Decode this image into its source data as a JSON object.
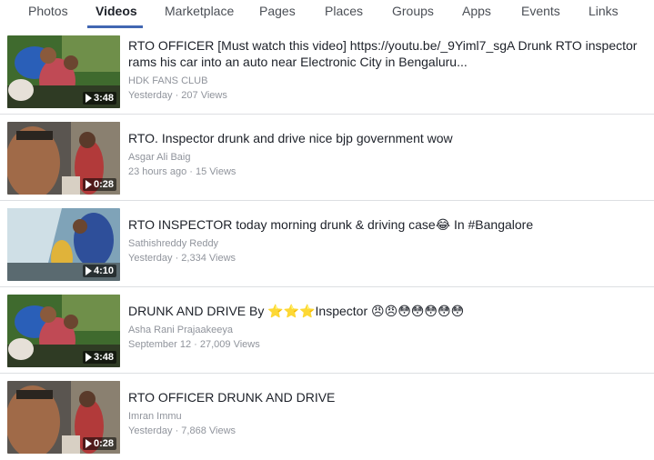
{
  "tabs": [
    {
      "label": "Photos",
      "active": false
    },
    {
      "label": "Videos",
      "active": true
    },
    {
      "label": "Marketplace",
      "active": false
    },
    {
      "label": "Pages",
      "active": false
    },
    {
      "label": "Places",
      "active": false
    },
    {
      "label": "Groups",
      "active": false
    },
    {
      "label": "Apps",
      "active": false
    },
    {
      "label": "Events",
      "active": false
    },
    {
      "label": "Links",
      "active": false
    }
  ],
  "accent_color": "#4267b2",
  "play_icon": "play-icon",
  "videos": [
    {
      "title": "RTO OFFICER [Must watch this video] https://youtu.be/_9Yiml7_sgA Drunk RTO inspector rams his car into an auto near Electronic City in Bengaluru...",
      "author": "HDK FANS CLUB",
      "meta": "Yesterday · 207 Views",
      "duration": "3:48"
    },
    {
      "title": "RTO. Inspector drunk and drive nice bjp government wow",
      "author": "Asgar Ali Baig",
      "meta": "23 hours ago · 15 Views",
      "duration": "0:28"
    },
    {
      "title": "RTO INSPECTOR today morning drunk & driving case😂 In #Bangalore",
      "author": "Sathishreddy Reddy",
      "meta": "Yesterday · 2,334 Views",
      "duration": "4:10"
    },
    {
      "title": "DRUNK AND DRIVE By ⭐⭐⭐Inspector 😠😠😳😳😳😳😳",
      "author": "Asha Rani Prajaakeeya",
      "meta": "September 12 · 27,009 Views",
      "duration": "3:48"
    },
    {
      "title": "RTO OFFICER DRUNK AND DRIVE",
      "author": "Imran Immu",
      "meta": "Yesterday · 7,868 Views",
      "duration": "0:28"
    }
  ]
}
